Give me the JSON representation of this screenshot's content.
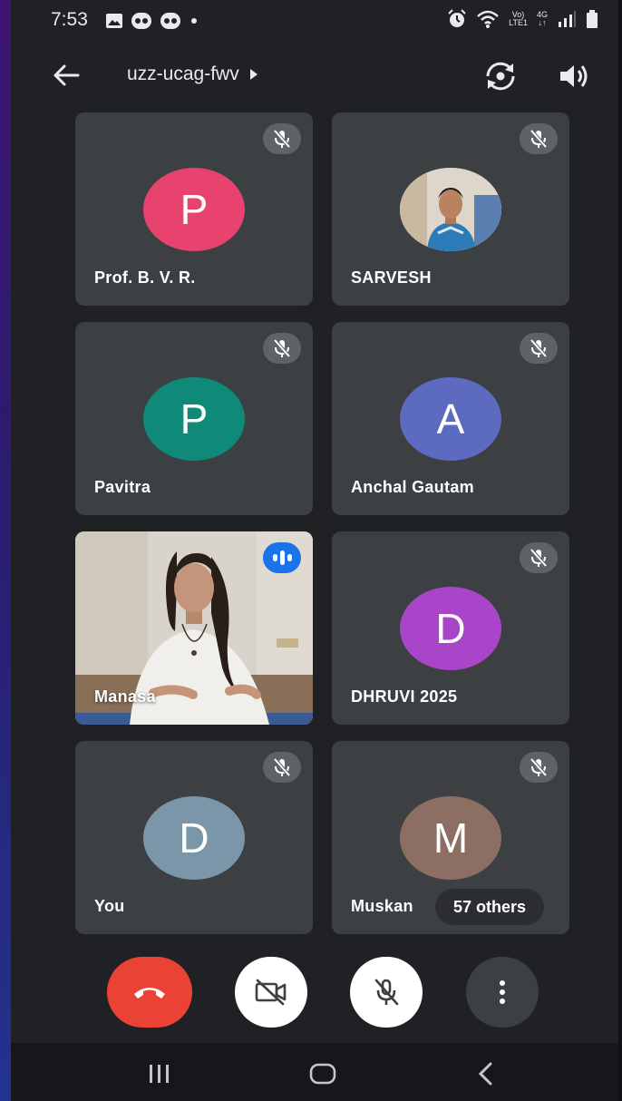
{
  "status_bar": {
    "time": "7:53",
    "net_top": "Vo)",
    "net_bottom": "LTE1",
    "net_gen": "4G"
  },
  "header": {
    "meeting_code": "uzz-ucag-fwv"
  },
  "participants": [
    {
      "name": "Prof. B. V. R.",
      "initial": "P",
      "avatar_color": "#e8436f",
      "muted": true
    },
    {
      "name": "SARVESH",
      "initial": "",
      "avatar_color": "#d8d3c9",
      "muted": true,
      "has_photo": true
    },
    {
      "name": "Pavitra",
      "initial": "P",
      "avatar_color": "#0f8a79",
      "muted": true
    },
    {
      "name": "Anchal Gautam",
      "initial": "A",
      "avatar_color": "#5c6bc0",
      "muted": true
    },
    {
      "name": "Manasa",
      "initial": "",
      "avatar_color": "#cfc8bd",
      "muted": false,
      "video_on": true,
      "speaking": true
    },
    {
      "name": "DHRUVI 2025",
      "initial": "D",
      "avatar_color": "#a845c8",
      "muted": true
    },
    {
      "name": "You",
      "initial": "D",
      "avatar_color": "#7b96a8",
      "muted": true
    },
    {
      "name": "Muskan",
      "initial": "M",
      "avatar_color": "#8d6e63",
      "muted": true
    }
  ],
  "others_label": "57 others",
  "controls": {
    "end_call_color": "#ea4335",
    "camera": "off",
    "microphone": "off"
  }
}
